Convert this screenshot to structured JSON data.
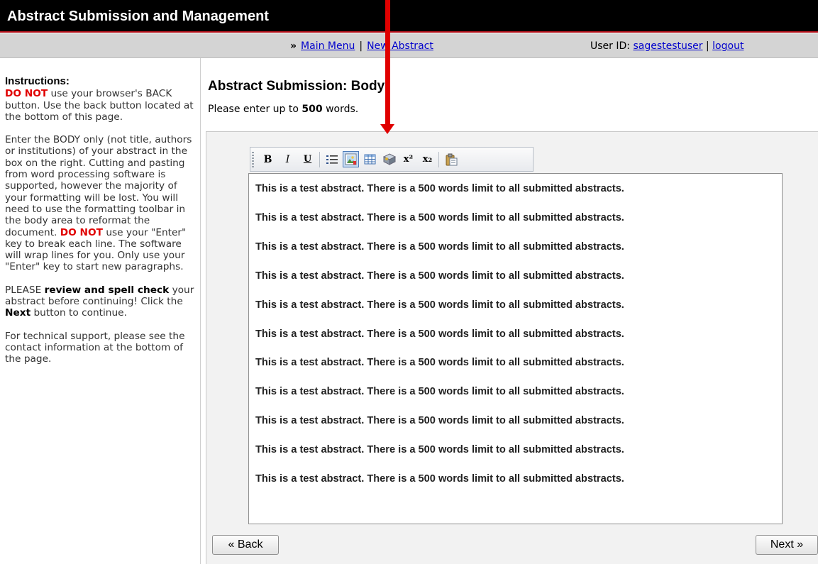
{
  "app": {
    "title": "Abstract Submission and Management"
  },
  "nav": {
    "prefix": "»",
    "main_menu": "Main Menu",
    "separator": "|",
    "new_abstract": "New Abstract",
    "user_label": "User ID:",
    "user_id": "sagestestuser",
    "logout": "logout"
  },
  "sidebar": {
    "heading": "Instructions:",
    "p1": {
      "warn": "DO NOT",
      "text": " use your browser's BACK button. Use the back button located at the bottom of this page."
    },
    "p2": {
      "a": "Enter the BODY only (not title, authors or institutions) of your abstract in the box on the right. Cutting and pasting from word processing software is supported, however the majority of your formatting will be lost. You will need to use the formatting toolbar in the body area to reformat the document. ",
      "warn": "DO NOT",
      "b": " use your \"Enter\" key to break each line. The software will wrap lines for you. Only use your \"Enter\" key to start new paragraphs."
    },
    "p3": {
      "a": "PLEASE ",
      "bold": "review and spell check",
      "b": " your abstract before continuing! Click the ",
      "next": "Next",
      "c": " button to continue."
    },
    "p4": "For technical support, please see the contact information at the bottom of the page."
  },
  "main": {
    "title": "Abstract Submission: Body",
    "instruction_pre": "Please enter up to ",
    "word_limit": "500",
    "instruction_post": " words."
  },
  "editor": {
    "paragraphs": [
      "This is a test abstract. There is a 500 words limit to all submitted abstracts.",
      "This is a test abstract. There is a 500 words limit to all submitted abstracts.",
      "This is a test abstract. There is a 500 words limit to all submitted abstracts.",
      "This is a test abstract. There is a 500 words limit to all submitted abstracts.",
      "This is a test abstract. There is a 500 words limit to all submitted abstracts.",
      "This is a test abstract. There is a 500 words limit to all submitted abstracts.",
      "This is a test abstract. There is a 500 words limit to all submitted abstracts.",
      "This is a test abstract. There is a 500 words limit to all submitted abstracts.",
      "This is a test abstract. There is a 500 words limit to all submitted abstracts.",
      "This is a test abstract. There is a 500 words limit to all submitted abstracts.",
      "This is a test abstract. There is a 500 words limit to all submitted abstracts."
    ]
  },
  "toolbar": {
    "bold": "B",
    "italic": "I",
    "underline": "U",
    "superscript": "x²",
    "subscript": "x₂",
    "icons": [
      "bold-icon",
      "italic-icon",
      "underline-icon",
      "bullet-list-icon",
      "insert-image-icon",
      "table-icon",
      "special-character-icon",
      "superscript-icon",
      "subscript-icon",
      "paste-icon"
    ],
    "active": "insert-image-icon"
  },
  "buttons": {
    "back": "« Back",
    "next": "Next »"
  },
  "colors": {
    "accent_red": "#e00000",
    "link": "#0000cc",
    "titlebar": "#000000"
  }
}
